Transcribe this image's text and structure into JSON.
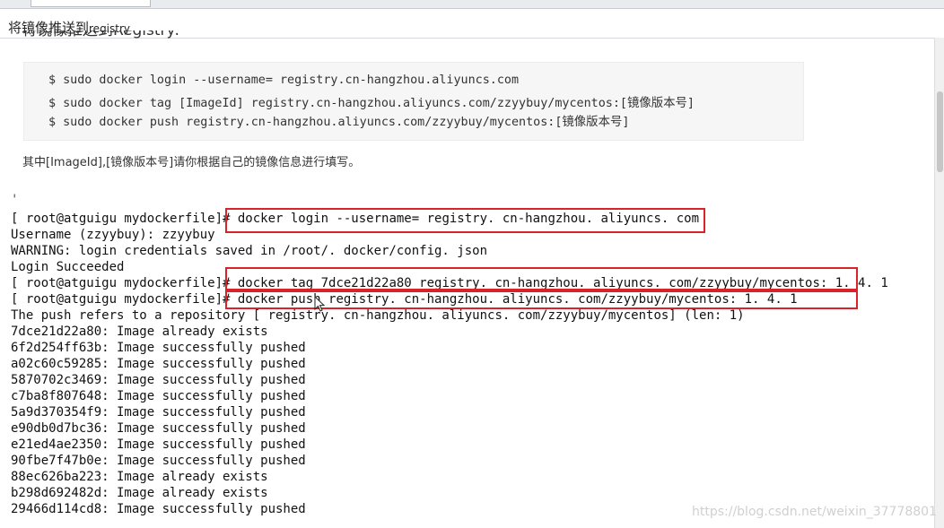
{
  "header": {
    "title_prefix": "将镜像推送到",
    "title_suffix": "registry",
    "cut_heading": "将镜像推送到Registry:"
  },
  "code_block": {
    "lines": [
      "$ sudo docker login --username= registry.cn-hangzhou.aliyuncs.com",
      "$ sudo docker tag [ImageId] registry.cn-hangzhou.aliyuncs.com/zzyybuy/mycentos:[镜像版本号]",
      "$ sudo docker push registry.cn-hangzhou.aliyuncs.com/zzyybuy/mycentos:[镜像版本号]"
    ]
  },
  "note": "其中[ImageId],[镜像版本号]请你根据自己的镜像信息进行填写。",
  "terminal": {
    "tick": "'",
    "prompt": "[ root@atguigu mydockerfile]# ",
    "cmd_login": "docker login --username= registry. cn-hangzhou. aliyuncs. com",
    "username_line": "Username (zzyybuy): zzyybuy",
    "warning_line": "WARNING: login credentials saved in /root/. docker/config. json",
    "login_ok": "Login Succeeded",
    "cmd_tag": "docker tag 7dce21d22a80  registry. cn-hangzhou. aliyuncs. com/zzyybuy/mycentos: 1. 4. 1",
    "cmd_push": "docker push registry. cn-hangzhou. aliyuncs. com/zzyybuy/mycentos: 1. 4. 1",
    "push_refers": "The push refers to a repository [ registry. cn-hangzhou. aliyuncs. com/zzyybuy/mycentos] (len: 1)",
    "layers": [
      "7dce21d22a80:  Image already exists",
      "6f2d254ff63b:  Image successfully pushed",
      "a02c60c59285:  Image successfully pushed",
      "5870702c3469:  Image successfully pushed",
      "c7ba8f807648:  Image successfully pushed",
      "5a9d370354f9:  Image successfully pushed",
      "e90db0d7bc36:  Image successfully pushed",
      "e21ed4ae2350:  Image successfully pushed",
      "90fbe7f47b0e:  Image successfully pushed",
      "88ec626ba223:  Image already exists",
      "b298d692482d:  Image already exists",
      "29466d114cd8:  Image successfully pushed"
    ]
  },
  "watermark": "https://blog.csdn.net/weixin_37778801",
  "colors": {
    "highlight_border": "#d9232b",
    "code_background": "#f6f6f6"
  }
}
